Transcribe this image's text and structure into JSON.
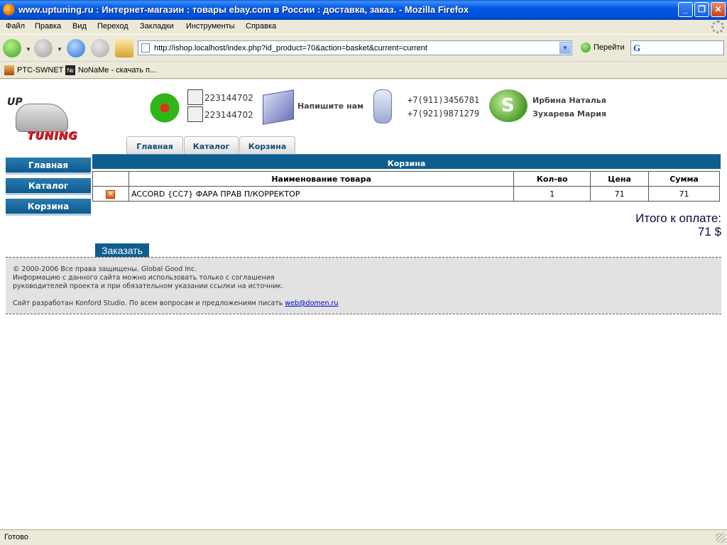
{
  "window": {
    "title": "www.uptuning.ru : Интернет-магазин : товары ebay.com в России : доставка, заказ. - Mozilla Firefox"
  },
  "menu": [
    "Файл",
    "Правка",
    "Вид",
    "Переход",
    "Закладки",
    "Инструменты",
    "Справка"
  ],
  "navigation": {
    "url": "http://ishop.localhost/index.php?id_product=70&action=basket&current=current",
    "go_label": "Перейти",
    "search_value": ""
  },
  "bookmarks": [
    "PTC-SWNET",
    "NoNaMe - скачать п..."
  ],
  "page": {
    "logo": {
      "top": "UP",
      "bottom": "TUNING"
    },
    "contacts": {
      "icq": [
        "223144702",
        "223144702"
      ],
      "write_us": "Напишите нам",
      "phones": [
        "+7(911)3456781",
        "+7(921)9871279"
      ],
      "people": [
        "Ирбина Наталья",
        "Зухарева Мария"
      ]
    },
    "tabs": [
      "Главная",
      "Каталог",
      "Корзина"
    ],
    "side_menu": [
      "Главная",
      "Каталог",
      "Корзина"
    ],
    "basket": {
      "title": "Корзина",
      "columns": [
        "",
        "Наименование товара",
        "Кол-во",
        "Цена",
        "Сумма"
      ],
      "rows": [
        {
          "name": "ACCORD {CC7} ФАРА ПРАВ П/КОРРЕКТОР",
          "qty": "1",
          "price": "71",
          "sum": "71"
        }
      ],
      "total_label": "Итого к оплате:",
      "total_value": "71 $",
      "order_button": "Заказать"
    },
    "footer": {
      "line1": "© 2000-2006 Все права защищены. Global Good Inc.",
      "line2": "Информацию с данного сайта можно использовать только с соглашения",
      "line3": "руководителей проекта и при обязательном указании ссылки на источник.",
      "line4": "Сайт разработан Konford Studio. По всем вопросам и предложениям писать",
      "email": "web@domen.ru"
    }
  },
  "status": {
    "text": "Готово"
  }
}
